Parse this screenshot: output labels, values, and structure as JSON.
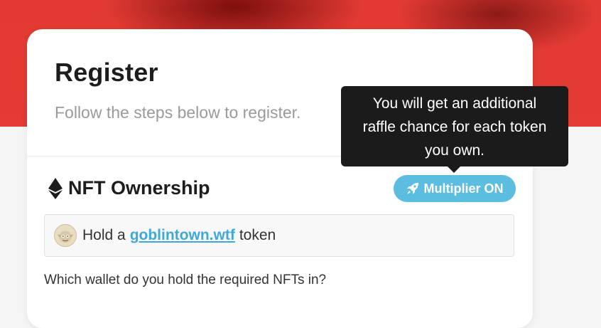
{
  "header": {
    "title": "Register",
    "subtitle": "Follow the steps below to register."
  },
  "section": {
    "title": "NFT Ownership",
    "icon": "ethereum-icon"
  },
  "multiplier": {
    "label": "Multiplier ON",
    "icon": "rocket-icon",
    "color": "#5bbde0"
  },
  "requirement": {
    "prefix": "Hold a",
    "link": "goblintown.wtf",
    "suffix": "token",
    "avatar_icon": "goblin-avatar-icon",
    "link_color": "#3ea8d6"
  },
  "question": "Which wallet do you hold the required NFTs in?",
  "tooltip": {
    "lines": [
      "You will get an additional",
      "raffle chance for each token",
      "you own."
    ]
  },
  "colors": {
    "hero": "#e53a35",
    "card": "#ffffff",
    "tooltip_bg": "#1b1b1b"
  }
}
